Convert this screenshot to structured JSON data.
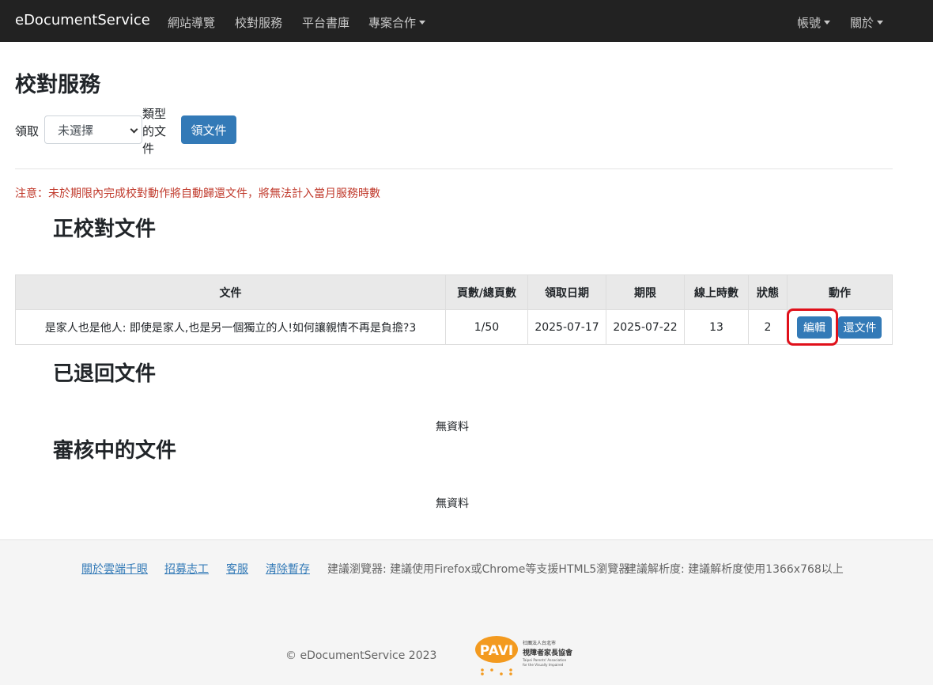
{
  "navbar": {
    "brand": "eDocumentService",
    "links": [
      "網站導覽",
      "校對服務",
      "平台書庫",
      "專案合作"
    ],
    "right": [
      "帳號",
      "關於"
    ]
  },
  "page": {
    "title": "校對服務",
    "claim_label": "領取",
    "select_value": "未選擇",
    "type_label": "類型的文件",
    "claim_button": "領文件",
    "notice": "注意：未於期限內完成校對動作將自動歸還文件，將無法計入當月服務時數"
  },
  "sections": {
    "proofreading": "正校對文件",
    "returned": "已退回文件",
    "reviewing": "審核中的文件",
    "no_data": "無資料"
  },
  "table": {
    "headers": [
      "文件",
      "頁數/總頁數",
      "領取日期",
      "期限",
      "線上時數",
      "狀態",
      "動作"
    ],
    "row": {
      "title": "是家人也是他人: 即使是家人,也是另一個獨立的人!如何讓親情不再是負擔?3",
      "pages": "1/50",
      "claim_date": "2025-07-17",
      "deadline": "2025-07-22",
      "hours": "13",
      "status": "2",
      "edit": "編輯",
      "return": "還文件"
    }
  },
  "footer": {
    "links": [
      "關於雲端千眼",
      "招募志工",
      "客服",
      "清除暫存"
    ],
    "browser_note": "建議瀏覽器: 建議使用Firefox或Chrome等支援HTML5瀏覽器",
    "resolution_note": "建議解析度: 建議解析度使用1366x768以上",
    "copyright": "© eDocumentService 2023",
    "logo_text": "PAVI",
    "logo_org_1": "社團法人台北市",
    "logo_org_2": "視障者家長協會",
    "logo_org_3": "Taipei Parents' Association",
    "logo_org_4": "for the Visually Impaired"
  },
  "colors": {
    "primary": "#337ab7",
    "navbar": "#222222",
    "danger": "#c0392b",
    "highlight": "#e0101a"
  }
}
